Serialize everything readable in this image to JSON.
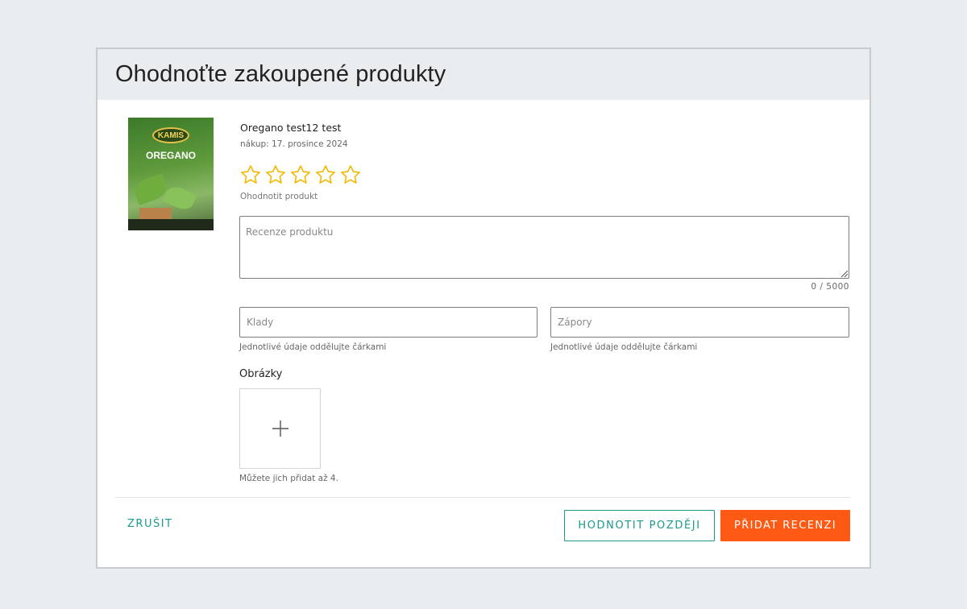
{
  "modal": {
    "title": "Ohodnoťte zakoupené produkty"
  },
  "product": {
    "package_brand": "KAMIS",
    "package_name": "OREGANO",
    "name": "Oregano test12 test",
    "purchase_date": "nákup: 17. prosince 2024",
    "rating": 0,
    "rating_max": 5,
    "rating_label": "Ohodnotit produkt",
    "star_color": "#f5b800"
  },
  "review": {
    "placeholder": "Recenze produktu",
    "value": "",
    "counter": "0 / 5000"
  },
  "pros": {
    "placeholder": "Klady",
    "hint": "Jednotlivé údaje oddělujte čárkami"
  },
  "cons": {
    "placeholder": "Zápory",
    "hint": "Jednotlivé údaje oddělujte čárkami"
  },
  "images": {
    "label": "Obrázky",
    "hint": "Můžete jich přidat až 4."
  },
  "actions": {
    "cancel_label": "ZRUŠIT",
    "later_label": "HODNOTIT POZDĚJI",
    "submit_label": "PŘIDAT RECENZI",
    "accent_color": "#1a9a8a",
    "submit_color": "#ff5a14"
  }
}
